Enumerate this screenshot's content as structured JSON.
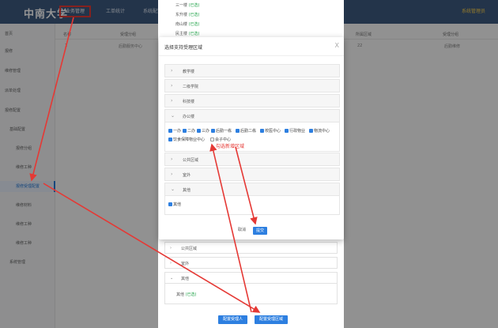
{
  "header": {
    "brand": "中南大学",
    "nav": [
      "业务管理",
      "工单统计",
      "系统配置"
    ],
    "user": "系统管理员"
  },
  "sidebar": {
    "items": [
      "首页",
      "报修",
      "维修管理",
      "派单处理",
      "报修配置",
      "基础配置",
      "报修分组",
      "维修工种",
      "报修受理配置",
      "维修材料",
      "维修工种",
      "维修工种",
      "系统管理"
    ]
  },
  "table": {
    "headers": [
      "名称",
      "受理分组",
      "所属区域",
      "受理分组"
    ],
    "row": [
      "1",
      "后勤服务中心",
      "22",
      "后勤维修"
    ]
  },
  "back_dialog": {
    "lines": [
      {
        "name": "三一楼",
        "state": "(已选)"
      },
      {
        "name": "东升楼",
        "state": "(已选)"
      },
      {
        "name": "南山楼",
        "state": "(已选)"
      },
      {
        "name": "民主楼",
        "state": "(已选)"
      }
    ],
    "panels": [
      "公共区域",
      "室外",
      "其他"
    ],
    "other_value": {
      "name": "其他",
      "state": "(已选)"
    },
    "buttons": [
      "配置受理人",
      "配置受理区域"
    ]
  },
  "modal": {
    "title": "选择支持受理区域",
    "close": "X",
    "sections": [
      {
        "label": "教学楼",
        "expanded": false
      },
      {
        "label": "二级学院",
        "expanded": false
      },
      {
        "label": "科技楼",
        "expanded": false
      },
      {
        "label": "办公楼",
        "expanded": true
      },
      {
        "label": "公共区域",
        "expanded": false
      },
      {
        "label": "室外",
        "expanded": false
      },
      {
        "label": "其他",
        "expanded": true
      }
    ],
    "office_options": [
      {
        "label": "一办",
        "checked": true
      },
      {
        "label": "二办",
        "checked": true
      },
      {
        "label": "三办",
        "checked": true
      },
      {
        "label": "后勤一栋",
        "checked": true
      },
      {
        "label": "后勤二栋",
        "checked": true
      },
      {
        "label": "校医中心",
        "checked": true
      },
      {
        "label": "行政物业",
        "checked": true
      },
      {
        "label": "物流中心",
        "checked": true
      },
      {
        "label": "饮食保障物业中心",
        "checked": true
      },
      {
        "label": "会子中心",
        "checked": false
      }
    ],
    "other_options": [
      {
        "label": "其他",
        "checked": true
      }
    ],
    "annotation": "勾选新增区域",
    "cancel": "取消",
    "submit": "提交"
  },
  "colors": {
    "header": "#3d5a80",
    "primary": "#2d7fe0",
    "annotation": "#e53935",
    "selected": "#22a34a"
  },
  "icons": [
    "chevron-right-icon",
    "chevron-down-icon",
    "checkbox-icon",
    "close-icon"
  ]
}
